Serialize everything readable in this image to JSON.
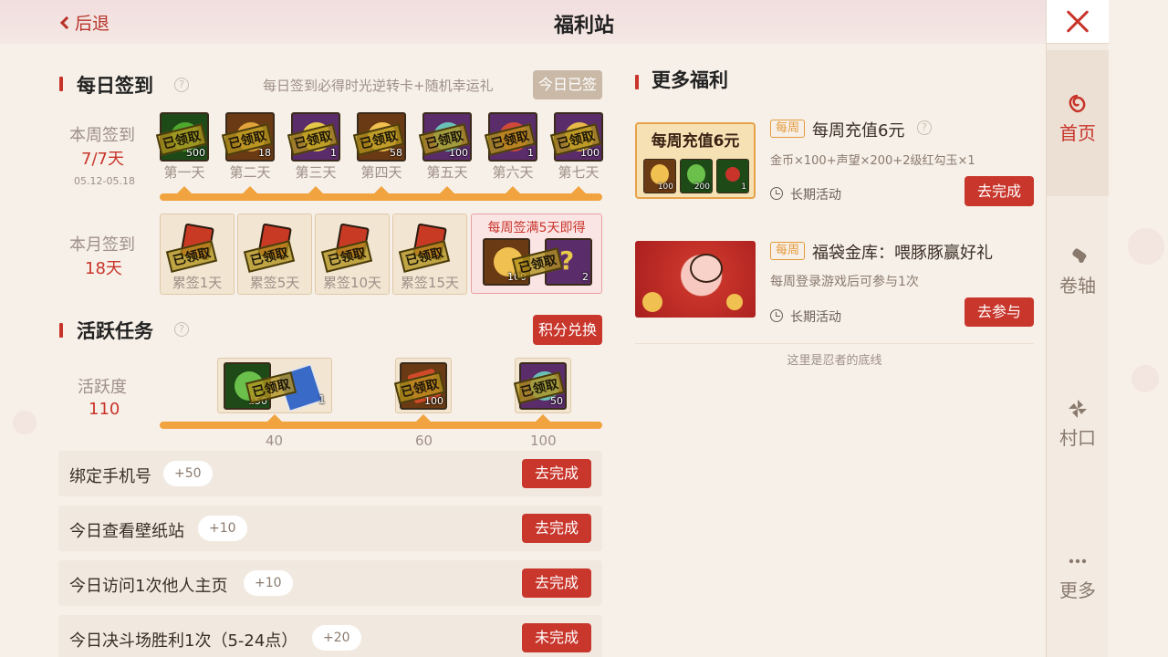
{
  "header": {
    "back_label": "后退",
    "title": "福利站"
  },
  "daily_signin": {
    "title": "每日签到",
    "help": "?",
    "desc": "每日签到必得时光逆转卡+随机幸运礼",
    "button": "今日已签",
    "week_label": "本周签到",
    "week_progress": "7/7天",
    "date_range": "05.12-05.18",
    "claimed_stamp": "已领取",
    "days": [
      {
        "label": "第一天",
        "count": "500",
        "color": "#4ea82e",
        "bg": "#1e4a18"
      },
      {
        "label": "第二天",
        "count": "18",
        "color": "#e0a23a",
        "bg": "#6a3a14"
      },
      {
        "label": "第三天",
        "count": "1",
        "color": "#e6c84a",
        "bg": "#5a2c6a"
      },
      {
        "label": "第四天",
        "count": "58",
        "color": "#f0c050",
        "bg": "#6a3a14"
      },
      {
        "label": "第五天",
        "count": "100",
        "color": "#6ac0b8",
        "bg": "#5a2c6a"
      },
      {
        "label": "第六天",
        "count": "1",
        "color": "#d04a3a",
        "bg": "#5a2c6a"
      },
      {
        "label": "第七天",
        "count": "100",
        "color": "#e8b848",
        "bg": "#5a2c6a"
      }
    ],
    "month_label": "本月签到",
    "month_progress": "18天",
    "cumulative": [
      {
        "label": "累签1天"
      },
      {
        "label": "累签5天"
      },
      {
        "label": "累签10天"
      },
      {
        "label": "累签15天"
      }
    ],
    "weekly_bonus": {
      "label": "每周签满5天即得",
      "items": [
        {
          "count": "100"
        },
        {
          "count": "2",
          "glyph": "?"
        }
      ]
    }
  },
  "active_tasks": {
    "title": "活跃任务",
    "help": "?",
    "button": "积分兑换",
    "score_label": "活跃度",
    "score": "110",
    "milestones": [
      {
        "value": "40",
        "items": [
          {
            "count": "150"
          },
          {
            "count": "1"
          }
        ]
      },
      {
        "value": "60",
        "items": [
          {
            "count": "100"
          }
        ]
      },
      {
        "value": "100",
        "items": [
          {
            "count": "50"
          }
        ]
      }
    ],
    "claimed_stamp": "已领取",
    "tasks": [
      {
        "name": "绑定手机号",
        "points": "+50",
        "button": "去完成"
      },
      {
        "name": "今日查看壁纸站",
        "points": "+10",
        "button": "去完成"
      },
      {
        "name": "今日访问1次他人主页",
        "points": "+10",
        "button": "去完成"
      },
      {
        "name": "今日决斗场胜利1次（5-24点）",
        "points": "+20",
        "button": "未完成"
      }
    ]
  },
  "more_benefits": {
    "title": "更多福利",
    "offers": [
      {
        "thumb_title": "每周充值6元",
        "tag": "每周",
        "title": "每周充值6元",
        "help": "?",
        "desc": "金币×100+声望×200+2级红勾玉×1",
        "period": "长期活动",
        "button": "去完成",
        "items": [
          {
            "count": "100"
          },
          {
            "count": "200"
          },
          {
            "count": "1"
          }
        ]
      },
      {
        "tag": "每周",
        "title": "福袋金库：喂豚豚赢好礼",
        "desc": "每周登录游戏后可参与1次",
        "period": "长期活动",
        "button": "去参与"
      }
    ],
    "footer": "这里是忍者的底线"
  },
  "sidebar": {
    "items": [
      {
        "label": "首页",
        "icon": "home-icon"
      },
      {
        "label": "卷轴",
        "icon": "scroll-icon"
      },
      {
        "label": "村口",
        "icon": "pinwheel-icon"
      },
      {
        "label": "更多",
        "icon": "more-icon"
      }
    ]
  }
}
